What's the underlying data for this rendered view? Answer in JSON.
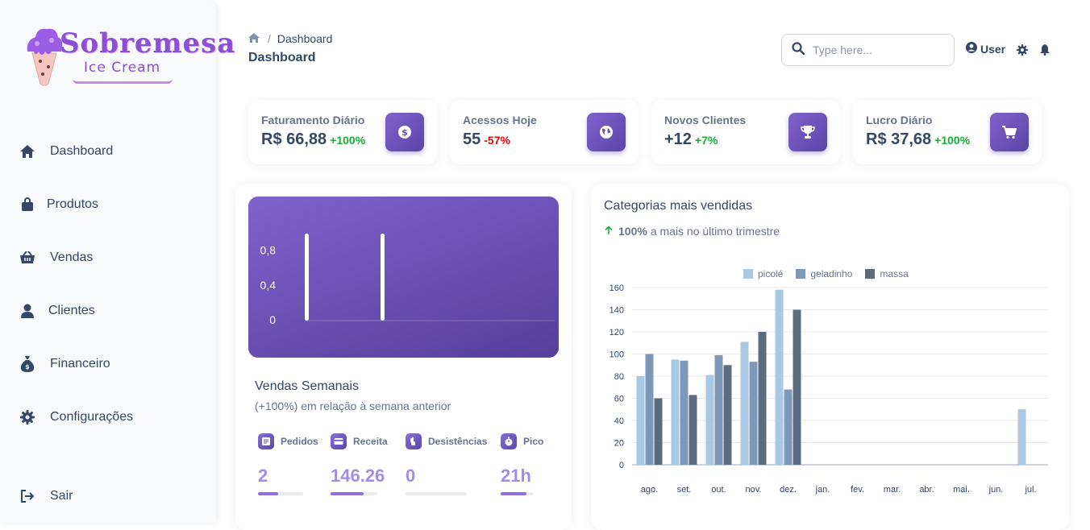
{
  "brand": {
    "title": "Sobremesa",
    "subtitle": "Ice Cream"
  },
  "sidebar": {
    "items": [
      {
        "label": "Dashboard",
        "icon": "home-icon"
      },
      {
        "label": "Produtos",
        "icon": "bag-icon"
      },
      {
        "label": "Vendas",
        "icon": "basket-icon"
      },
      {
        "label": "Clientes",
        "icon": "user-icon"
      },
      {
        "label": "Financeiro",
        "icon": "money-bag-icon"
      },
      {
        "label": "Configurações",
        "icon": "gear-icon"
      }
    ],
    "logout": {
      "label": "Sair",
      "icon": "logout-icon"
    }
  },
  "header": {
    "breadcrumb": "Dashboard",
    "title": "Dashboard",
    "search_placeholder": "Type here...",
    "user_label": "User"
  },
  "stats": [
    {
      "title": "Faturamento Diário",
      "value": "R$ 66,88",
      "change": "+100%",
      "trend": "pos",
      "icon": "dollar-icon"
    },
    {
      "title": "Acessos Hoje",
      "value": "55",
      "change": "-57%",
      "trend": "neg",
      "icon": "globe-icon"
    },
    {
      "title": "Novos Clientes",
      "value": "+12",
      "change": "+7%",
      "trend": "pos",
      "icon": "trophy-icon"
    },
    {
      "title": "Lucro Diário",
      "value": "R$ 37,68",
      "change": "+100%",
      "trend": "pos",
      "icon": "cart-icon"
    }
  ],
  "weekly": {
    "title": "Vendas Semanais",
    "subtitle": "(+100%) em relação à semana anterior",
    "kpis": [
      {
        "label": "Pedidos",
        "value": "2",
        "progress": 0.45,
        "icon": "receipt-icon"
      },
      {
        "label": "Receita",
        "value": "146.26",
        "progress": 0.7,
        "icon": "credit-card-icon"
      },
      {
        "label": "Desistências",
        "value": "0",
        "progress": 0.0,
        "icon": "thumbs-down-icon"
      },
      {
        "label": "Pico",
        "value": "21h",
        "progress": 0.8,
        "icon": "stopwatch-icon"
      }
    ]
  },
  "categories": {
    "title": "Categorias mais vendidas",
    "highlight": "100%",
    "subtitle_rest": "a mais no último trimestre"
  },
  "colors": {
    "accent": "#5e48ab",
    "positive": "#17ad37",
    "negative": "#ea0606",
    "picole": "#a8c8e3",
    "geladinho": "#7e98b8",
    "massa": "#5d6b80"
  },
  "chart_data": [
    {
      "type": "bar",
      "title": "",
      "yticks": [
        "0",
        "0,4",
        "0,8"
      ],
      "ylim": [
        0,
        1
      ],
      "values": [
        1,
        1
      ],
      "grid": false
    },
    {
      "type": "bar",
      "title": "",
      "categories": [
        "ago.",
        "set.",
        "out.",
        "nov.",
        "dez.",
        "jan.",
        "fev.",
        "mar.",
        "abr.",
        "mai.",
        "jun.",
        "jul."
      ],
      "series": [
        {
          "name": "picolé",
          "color": "#a8c8e3",
          "values": [
            80,
            95,
            81,
            111,
            158,
            0,
            0,
            0,
            0,
            0,
            0,
            50
          ]
        },
        {
          "name": "geladinho",
          "color": "#7e98b8",
          "values": [
            100,
            94,
            99,
            93,
            68,
            0,
            0,
            0,
            0,
            0,
            0,
            0
          ]
        },
        {
          "name": "massa",
          "color": "#5d6b80",
          "values": [
            60,
            63,
            90,
            120,
            140,
            0,
            0,
            0,
            0,
            0,
            0,
            0
          ]
        }
      ],
      "yticks": [
        0,
        20,
        40,
        60,
        80,
        100,
        120,
        140,
        160
      ],
      "ylim": [
        0,
        160
      ],
      "legend": "top-center",
      "grid": true
    }
  ]
}
